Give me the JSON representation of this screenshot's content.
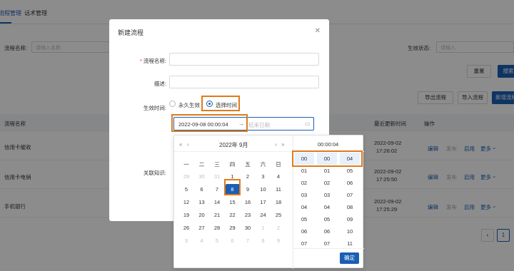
{
  "tabs": [
    {
      "label": "流程管理"
    },
    {
      "label": "话术管理"
    }
  ],
  "filter": {
    "name_label": "流程名称:",
    "name_placeholder": "请输入名称",
    "status_label": "生效状态:",
    "status_placeholder": "请输入",
    "reset": "重置",
    "search": "搜索"
  },
  "actions": {
    "export": "导出流程",
    "import": "导入流程",
    "create": "新增流程"
  },
  "table": {
    "col_name": "流程名称",
    "col_updated": "最近更新时间",
    "col_op": "操作",
    "rows": [
      {
        "name": "信用卡催收",
        "date": "2022-09-02",
        "time": "17:26:02"
      },
      {
        "name": "信用卡电销",
        "date": "2022-09-02",
        "time": "17:25:50"
      },
      {
        "name": "手机银行",
        "date": "2022-09-02",
        "time": "17:25:29"
      }
    ],
    "op_edit": "编辑",
    "op_publish": "发布",
    "op_enable": "启用",
    "op_more": "更多"
  },
  "pager": {
    "current": "1"
  },
  "modal": {
    "title": "新建流程",
    "name_label": "流程名称:",
    "desc_label": "描述:",
    "effective_label": "生效时间:",
    "option_forever": "永久生效",
    "option_select": "选择时间",
    "link_label": "关联知识:"
  },
  "date_range": {
    "start": "2022-09-08 00:00:04",
    "separator": "→",
    "end_placeholder": "结束日期"
  },
  "calendar": {
    "year": "2022年",
    "month": "9月",
    "weekdays": [
      "一",
      "二",
      "三",
      "四",
      "五",
      "六",
      "日"
    ],
    "days": [
      [
        "29",
        "30",
        "31",
        "1",
        "2",
        "3",
        "4"
      ],
      [
        "5",
        "6",
        "7",
        "8",
        "9",
        "10",
        "11"
      ],
      [
        "12",
        "13",
        "14",
        "15",
        "16",
        "17",
        "18"
      ],
      [
        "19",
        "20",
        "21",
        "22",
        "23",
        "24",
        "25"
      ],
      [
        "26",
        "27",
        "28",
        "29",
        "30",
        "1",
        "2"
      ],
      [
        "3",
        "4",
        "5",
        "6",
        "7",
        "8",
        "9"
      ]
    ],
    "selected_day": "8"
  },
  "time": {
    "display": "00:00:04",
    "hours": [
      "00",
      "01",
      "02",
      "03",
      "04",
      "05",
      "06",
      "07"
    ],
    "minutes": [
      "00",
      "01",
      "02",
      "03",
      "04",
      "05",
      "06",
      "07"
    ],
    "seconds": [
      "04",
      "05",
      "06",
      "07",
      "08",
      "09",
      "10",
      "11"
    ],
    "confirm": "确定"
  },
  "colors": {
    "primary": "#1a5fb4",
    "highlight": "#e07b1b"
  }
}
